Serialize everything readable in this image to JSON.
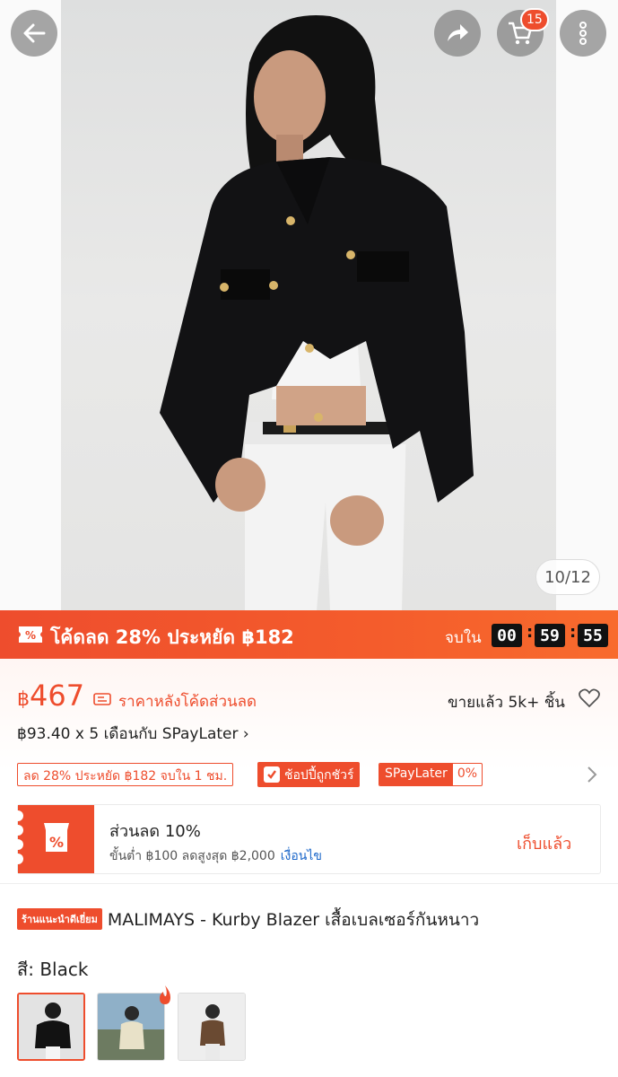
{
  "header": {
    "cart_count": "15",
    "image_counter": "10/12"
  },
  "promo": {
    "text": "โค้ดลด 28% ประหยัด ฿182",
    "ends_label": "จบใน",
    "hours": "00",
    "minutes": "59",
    "seconds": "55"
  },
  "price": {
    "currency": "฿",
    "amount": "467",
    "note": "ราคาหลังโค้ดส่วนลด",
    "sold": "ขายแล้ว 5k+ ชิ้น",
    "paylater": "฿93.40 x 5 เดือนกับ SPayLater",
    "paylater_chevron": "›"
  },
  "chips": {
    "discount": "ลด 28% ประหยัด ฿182 จบใน 1 ชม.",
    "guarantee": "ช้อปปี้ถูกชัวร์",
    "spaylater": "SPayLater",
    "spaylater_rate": "0%"
  },
  "voucher": {
    "title": "ส่วนลด 10%",
    "subtitle": "ขั้นต่ำ ฿100 ลดสูงสุด ฿2,000",
    "conditions_link": "เงื่อนไข",
    "collect_label": "เก็บแล้ว"
  },
  "product": {
    "badge": "ร้านแนะนำดีเยี่ยม",
    "title": "MALIMAYS - Kurby Blazer เสื้อเบลเซอร์กันหนาว",
    "color_label": "สี:",
    "color_value": "Black"
  },
  "colors": {
    "accent": "#ee4d2d",
    "link": "#1a66c9"
  },
  "icons": [
    "back-arrow-icon",
    "share-icon",
    "cart-icon",
    "more-icon",
    "ticket-icon",
    "price-tag-icon",
    "heart-icon",
    "guarantee-icon",
    "chevron-right-icon",
    "shop-voucher-icon",
    "flame-icon"
  ]
}
